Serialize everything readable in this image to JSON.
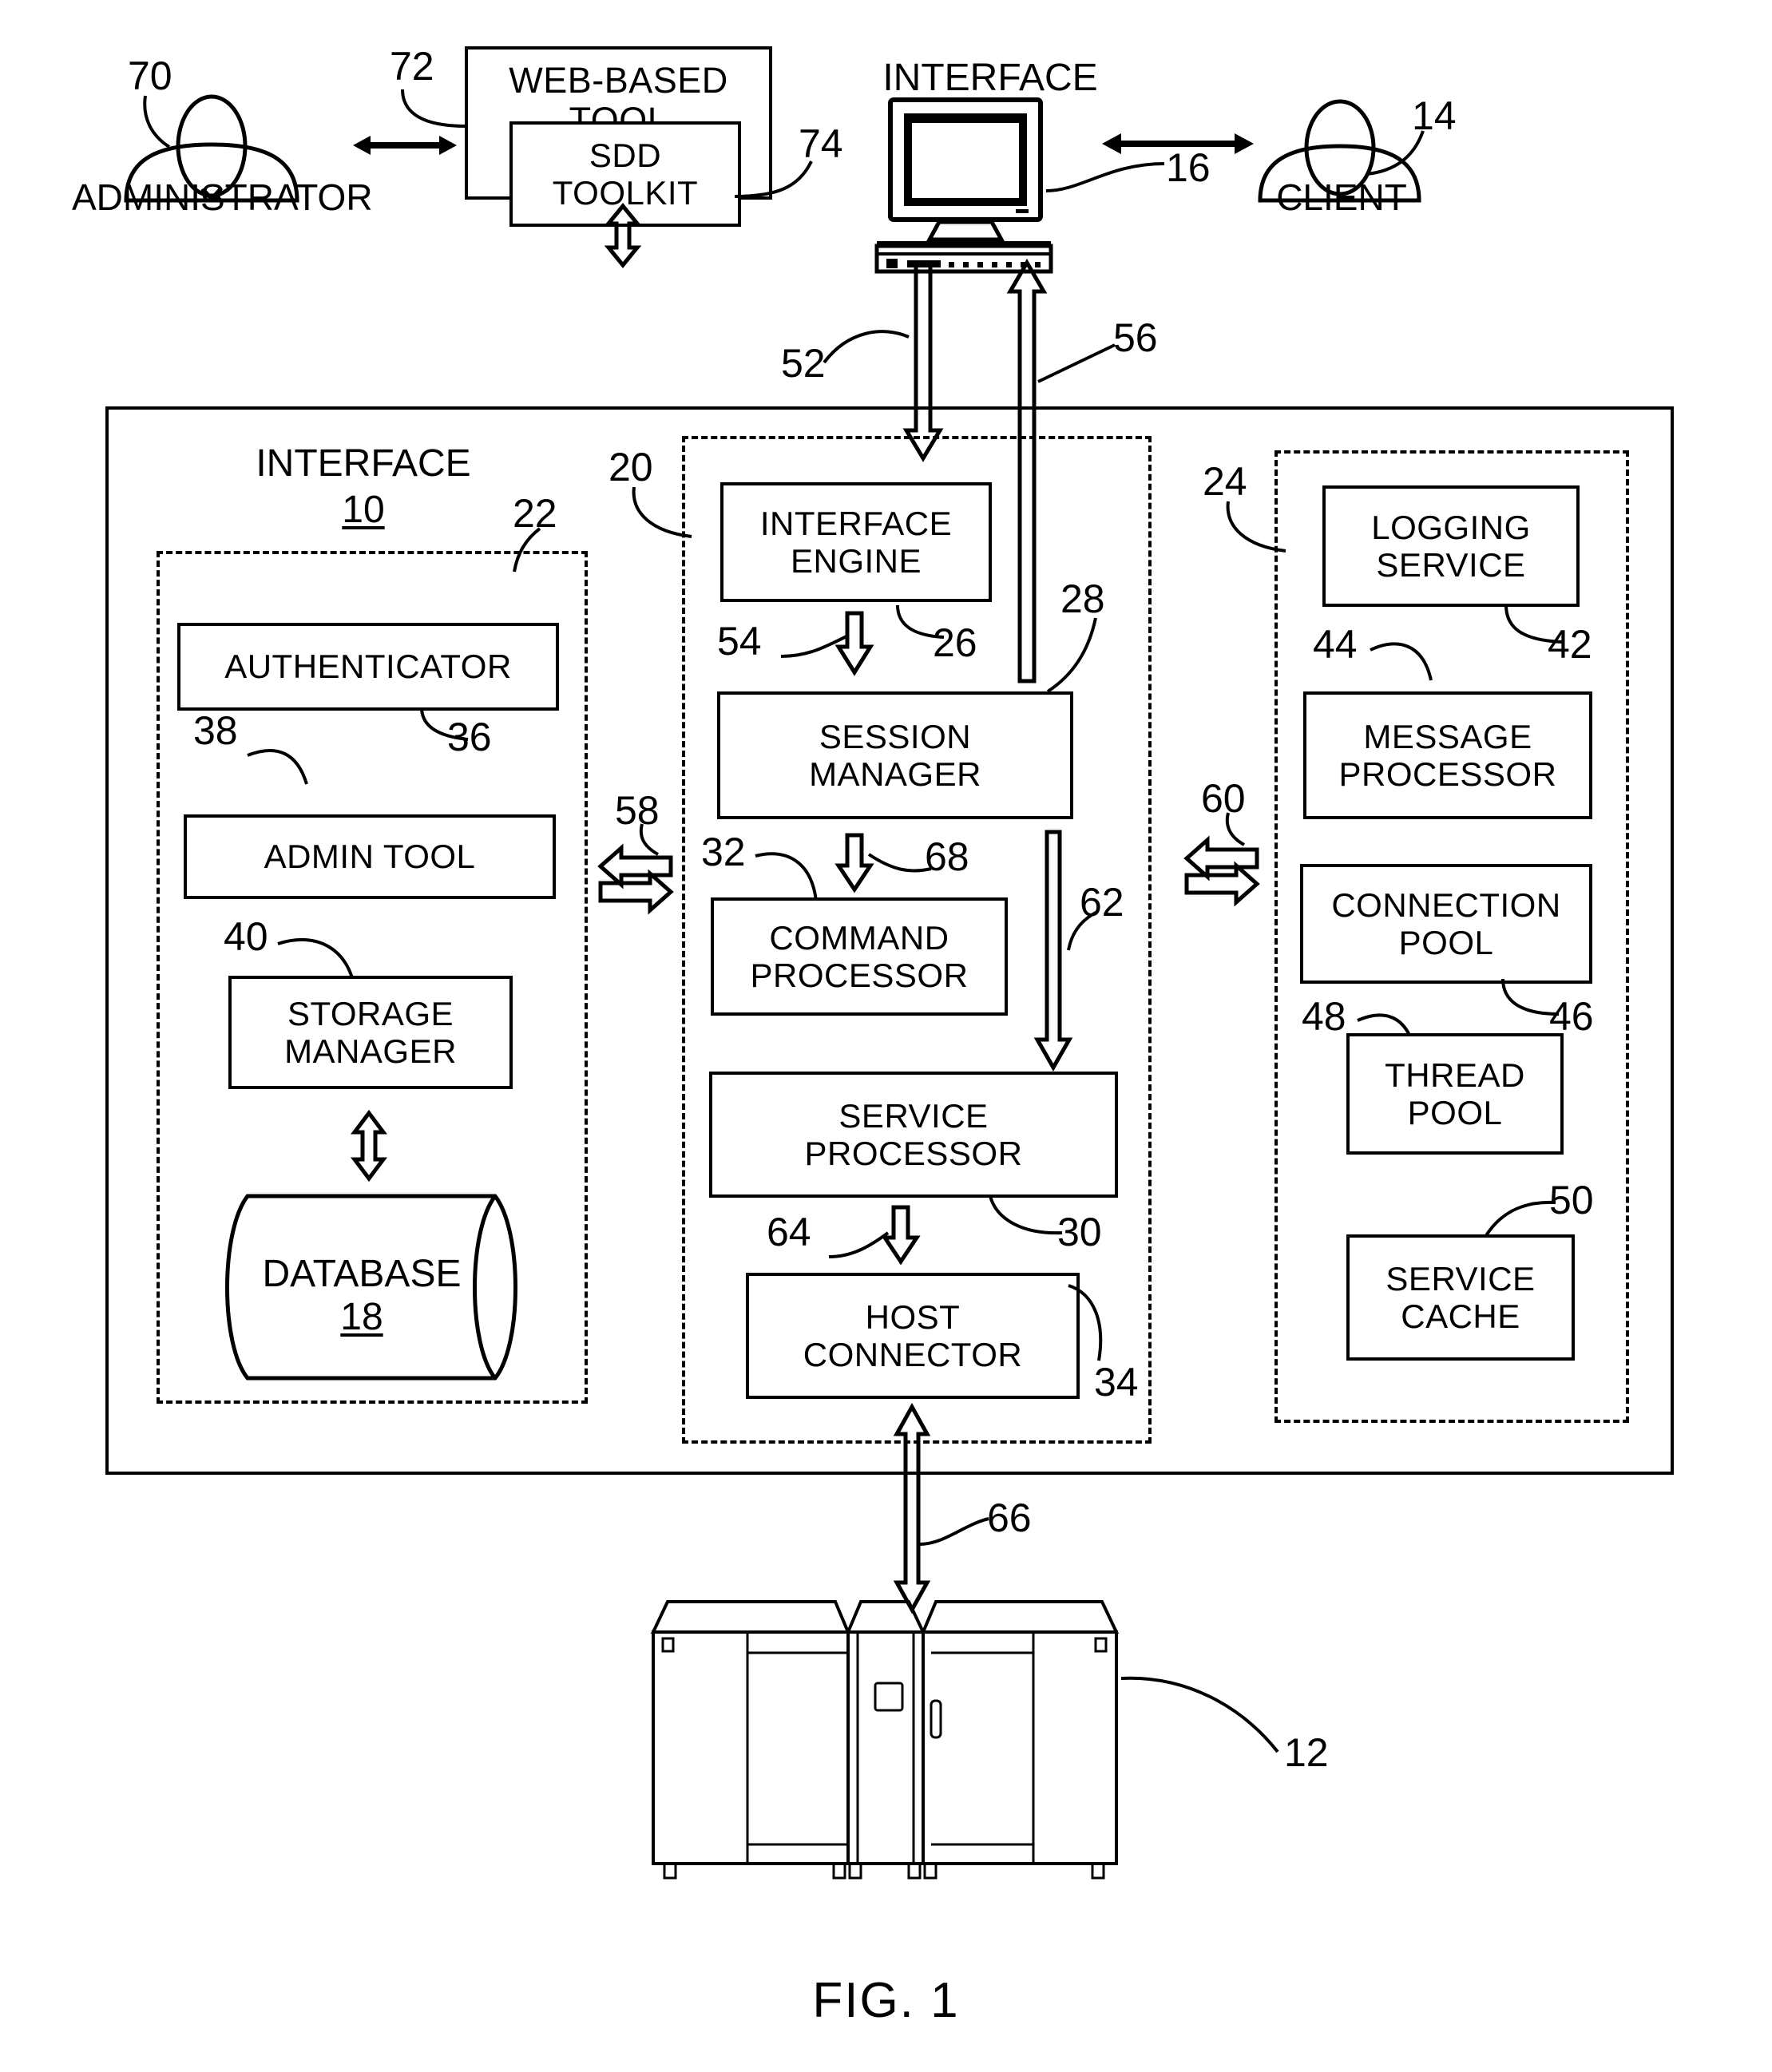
{
  "figure": {
    "caption": "FIG. 1",
    "title_interface_top": "INTERFACE"
  },
  "actors": {
    "administrator": {
      "label": "ADMINISTRATOR",
      "ref": "70"
    },
    "client": {
      "label": "CLIENT",
      "ref": "14"
    }
  },
  "web_tool": {
    "label": "WEB-BASED TOOL",
    "line1": "WEB-BASED",
    "line2": "TOOL",
    "ref": "72",
    "inner": {
      "line1": "SDD",
      "line2": "TOOLKIT",
      "label": "SDD TOOLKIT",
      "ref": "74"
    }
  },
  "workstation": {
    "title": "INTERFACE",
    "ref": "16"
  },
  "system": {
    "title": "INTERFACE",
    "ref": "10",
    "groups": [
      {
        "name": "admin-group",
        "ref": "22",
        "boxes": [
          {
            "label": "AUTHENTICATOR",
            "lines": [
              "AUTHENTICATOR"
            ],
            "ref": "36"
          },
          {
            "label": "ADMIN TOOL",
            "lines": [
              "ADMIN TOOL"
            ],
            "ref": "38"
          },
          {
            "label": "STORAGE MANAGER",
            "lines": [
              "STORAGE",
              "MANAGER"
            ],
            "ref": "40"
          }
        ],
        "database": {
          "label": "DATABASE",
          "ref": "18"
        }
      },
      {
        "name": "engine-group",
        "ref": "20",
        "boxes": [
          {
            "label": "INTERFACE ENGINE",
            "lines": [
              "INTERFACE",
              "ENGINE"
            ],
            "ref": "26"
          },
          {
            "label": "SESSION MANAGER",
            "lines": [
              "SESSION",
              "MANAGER"
            ],
            "ref": "28"
          },
          {
            "label": "COMMAND PROCESSOR",
            "lines": [
              "COMMAND",
              "PROCESSOR"
            ],
            "ref": "32"
          },
          {
            "label": "SERVICE PROCESSOR",
            "lines": [
              "SERVICE",
              "PROCESSOR"
            ],
            "ref": "30"
          },
          {
            "label": "HOST CONNECTOR",
            "lines": [
              "HOST",
              "CONNECTOR"
            ],
            "ref": "34"
          }
        ]
      },
      {
        "name": "services-group",
        "ref": "24",
        "boxes": [
          {
            "label": "LOGGING SERVICE",
            "lines": [
              "LOGGING",
              "SERVICE"
            ],
            "ref": "42"
          },
          {
            "label": "MESSAGE PROCESSOR",
            "lines": [
              "MESSAGE",
              "PROCESSOR"
            ],
            "ref": "44"
          },
          {
            "label": "CONNECTION POOL",
            "lines": [
              "CONNECTION",
              "POOL"
            ],
            "ref": "46"
          },
          {
            "label": "THREAD POOL",
            "lines": [
              "THREAD",
              "POOL"
            ],
            "ref": "48"
          },
          {
            "label": "SERVICE CACHE",
            "lines": [
              "SERVICE",
              "CACHE"
            ],
            "ref": "50"
          }
        ]
      }
    ]
  },
  "mainframe": {
    "ref": "12"
  },
  "flow_refs": {
    "inbound_from_interface": "52",
    "outbound_to_interface": "56",
    "engine_to_session": "54",
    "session_to_command": "68",
    "session_to_service_side": "62",
    "service_to_host": "64",
    "host_to_mainframe": "66",
    "admin_bus": "58",
    "services_bus": "60"
  }
}
